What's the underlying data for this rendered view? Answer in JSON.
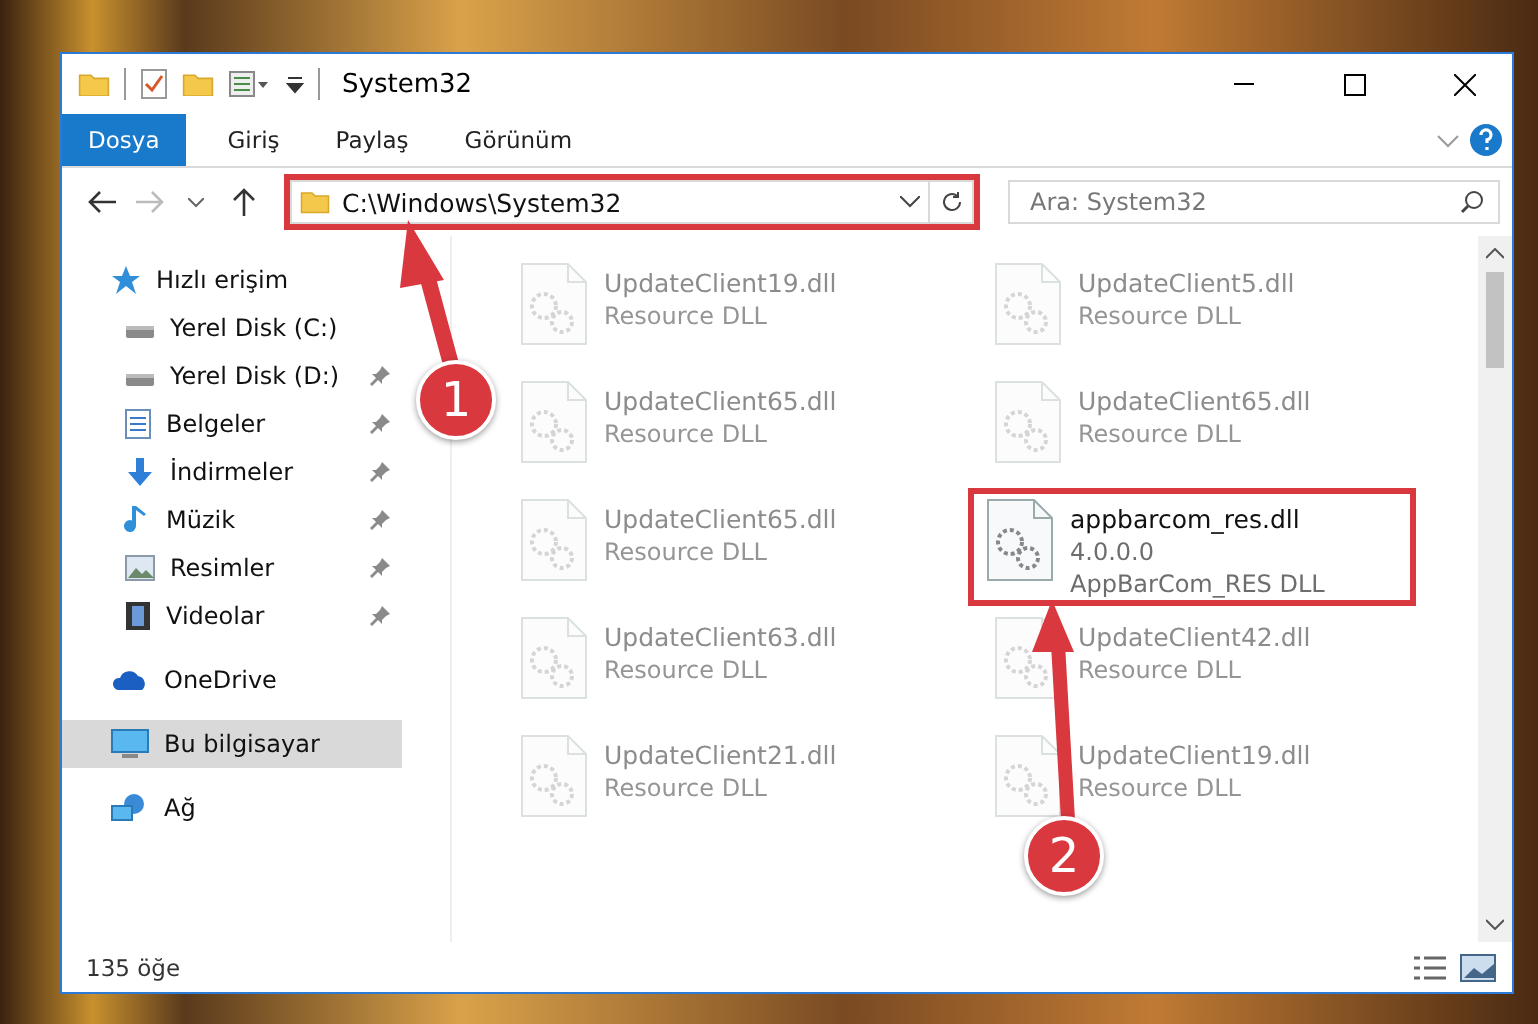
{
  "window": {
    "title": "System32"
  },
  "ribbon": {
    "tabs": [
      {
        "label": "Dosya",
        "selected": true
      },
      {
        "label": "Giriş",
        "selected": false
      },
      {
        "label": "Paylaş",
        "selected": false
      },
      {
        "label": "Görünüm",
        "selected": false
      }
    ]
  },
  "address": {
    "path": "C:\\Windows\\System32",
    "highlighted": true
  },
  "search": {
    "placeholder": "Ara: System32"
  },
  "sidebar": {
    "items": [
      {
        "label": "Hızlı erişim",
        "kind": "star",
        "selected": false,
        "children": [
          {
            "label": "Yerel Disk (C:)",
            "kind": "disk",
            "pinned": false
          },
          {
            "label": "Yerel Disk (D:)",
            "kind": "disk",
            "pinned": true
          },
          {
            "label": "Belgeler",
            "kind": "doc",
            "pinned": true
          },
          {
            "label": "İndirmeler",
            "kind": "download",
            "pinned": true
          },
          {
            "label": "Müzik",
            "kind": "music",
            "pinned": true
          },
          {
            "label": "Resimler",
            "kind": "picture",
            "pinned": true
          },
          {
            "label": "Videolar",
            "kind": "video",
            "pinned": true
          }
        ]
      },
      {
        "label": "OneDrive",
        "kind": "cloud",
        "selected": false
      },
      {
        "label": "Bu bilgisayar",
        "kind": "computer",
        "selected": true
      },
      {
        "label": "Ağ",
        "kind": "network",
        "selected": false
      }
    ]
  },
  "files": [
    {
      "name": "UpdateClient19.dll",
      "details": [
        "Resource DLL"
      ],
      "blurred": true,
      "highlighted": false
    },
    {
      "name": "UpdateClient5.dll",
      "details": [
        "Resource DLL"
      ],
      "blurred": true,
      "highlighted": false
    },
    {
      "name": "UpdateClient65.dll",
      "details": [
        "Resource DLL"
      ],
      "blurred": true,
      "highlighted": false
    },
    {
      "name": "UpdateClient65.dll",
      "details": [
        "Resource DLL"
      ],
      "blurred": true,
      "highlighted": false
    },
    {
      "name": "UpdateClient65.dll",
      "details": [
        "Resource DLL"
      ],
      "blurred": true,
      "highlighted": false
    },
    {
      "name": "appbarcom_res.dll",
      "details": [
        "4.0.0.0",
        "AppBarCom_RES DLL"
      ],
      "blurred": false,
      "highlighted": true
    },
    {
      "name": "UpdateClient63.dll",
      "details": [
        "Resource DLL"
      ],
      "blurred": true,
      "highlighted": false
    },
    {
      "name": "UpdateClient42.dll",
      "details": [
        "Resource DLL"
      ],
      "blurred": true,
      "highlighted": false
    },
    {
      "name": "UpdateClient21.dll",
      "details": [
        "Resource DLL"
      ],
      "blurred": true,
      "highlighted": false
    },
    {
      "name": "UpdateClient19.dll",
      "details": [
        "Resource DLL"
      ],
      "blurred": true,
      "highlighted": false
    }
  ],
  "status_bar": {
    "count": "135 öğe"
  },
  "annotations": [
    {
      "label": "1"
    },
    {
      "label": "2"
    }
  ]
}
